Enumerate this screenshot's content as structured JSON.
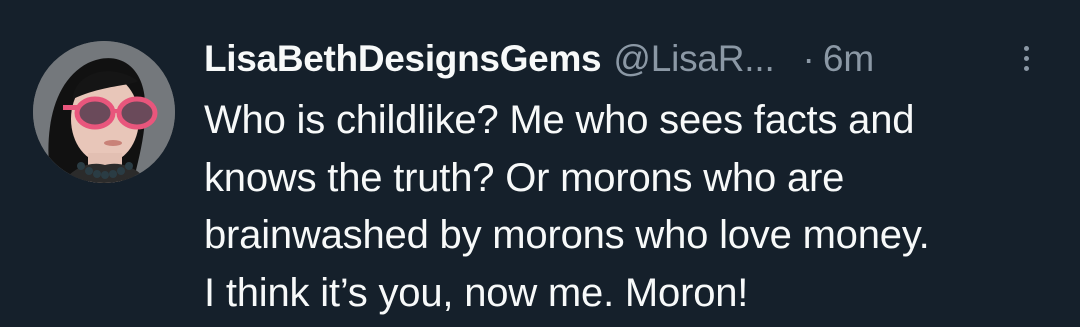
{
  "tweet": {
    "display_name": "LisaBethDesignsGems",
    "handle": "@LisaR...",
    "separator": "·",
    "time": "6m",
    "avatar_icon": "avatar-photo",
    "more_icon": "more-vertical-icon",
    "text_lines": [
      "Who is childlike? Me who sees facts and",
      "knows the truth? Or morons who are",
      "brainwashed by morons who love money.",
      "I think it’s you, now me. Moron!"
    ]
  },
  "colors": {
    "background": "#15202b",
    "text": "#f7f9f9",
    "secondary_text": "#8b98a5"
  }
}
